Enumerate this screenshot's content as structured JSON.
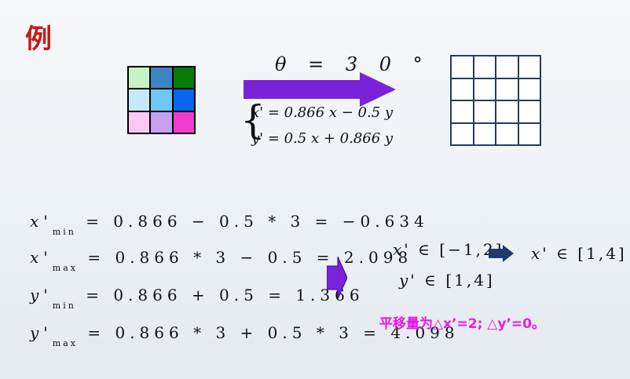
{
  "title": "例",
  "source_grid": {
    "colors": [
      "#c6f2c6",
      "#3c84c6",
      "#0a7a0a",
      "#c4eaf9",
      "#6ec8f6",
      "#0a64ee",
      "#fac8f2",
      "#c79ef0",
      "#f03cce"
    ]
  },
  "rotation": {
    "label": "θ = 3 0 °"
  },
  "transform": {
    "eq1": "x' = 0.866 x − 0.5 y",
    "eq2": "y' = 0.5 x + 0.866 y"
  },
  "calculations": [
    {
      "var": "x'",
      "sub": "min",
      "expr": "= 0.866 − 0.5 * 3 = −0.634"
    },
    {
      "var": "x'",
      "sub": "max",
      "expr": "= 0.866 * 3 − 0.5 = 2.098"
    },
    {
      "var": "y'",
      "sub": "min",
      "expr": "= 0.866 + 0.5 = 1.366"
    },
    {
      "var": "y'",
      "sub": "max",
      "expr": "= 0.866 * 3 + 0.5 * 3 = 4.098"
    }
  ],
  "ranges": {
    "x_var": "x'",
    "x_range": "∈ [−1,2]",
    "x_shift_var": "x'",
    "x_shift_range": "∈ [1,4]",
    "y_var": "y'",
    "y_range": "∈ [1,4]"
  },
  "shift_text": "平移量为△x’=2;  △y’=0。",
  "colors": {
    "title": "#c8171a",
    "arrow": "#7a22d8",
    "arrow_dark": "#1f3a6e",
    "shift_text": "#e61ce0"
  }
}
